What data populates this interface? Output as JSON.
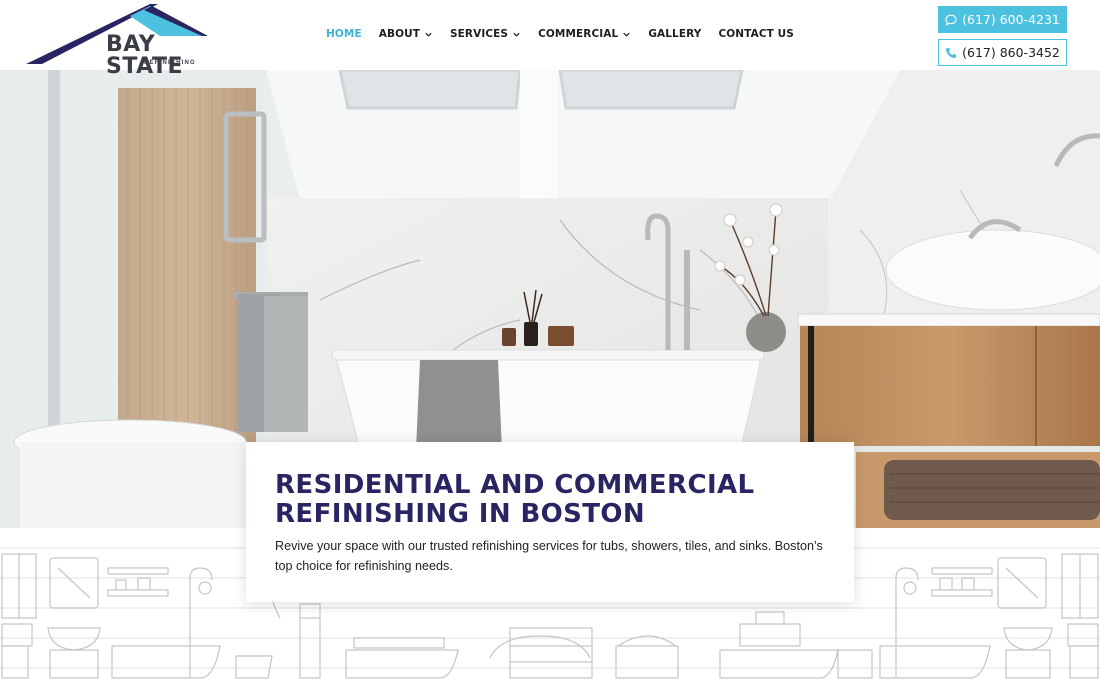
{
  "brand": {
    "name": "BAY STATE",
    "tagline": "REFINISHING",
    "colors": {
      "navy": "#282562",
      "accent": "#4cc1e0",
      "text": "#1e1e1e"
    }
  },
  "nav": {
    "items": [
      {
        "label": "HOME",
        "active": true,
        "dropdown": false
      },
      {
        "label": "ABOUT",
        "active": false,
        "dropdown": true
      },
      {
        "label": "SERVICES",
        "active": false,
        "dropdown": true
      },
      {
        "label": "COMMERCIAL",
        "active": false,
        "dropdown": true
      },
      {
        "label": "GALLERY",
        "active": false,
        "dropdown": false
      },
      {
        "label": "CONTACT US",
        "active": false,
        "dropdown": false
      }
    ]
  },
  "contact": {
    "primary_phone": "(617) 600-4231",
    "primary_icon": "chat-bubble-icon",
    "secondary_phone": "(617) 860-3452",
    "secondary_icon": "phone-icon"
  },
  "hero": {
    "title": "RESIDENTIAL AND COMMERCIAL REFINISHING IN BOSTON",
    "description": "Revive your space with our trusted refinishing services for tubs, showers, tiles, and sinks. Boston’s top choice for refinishing needs."
  }
}
